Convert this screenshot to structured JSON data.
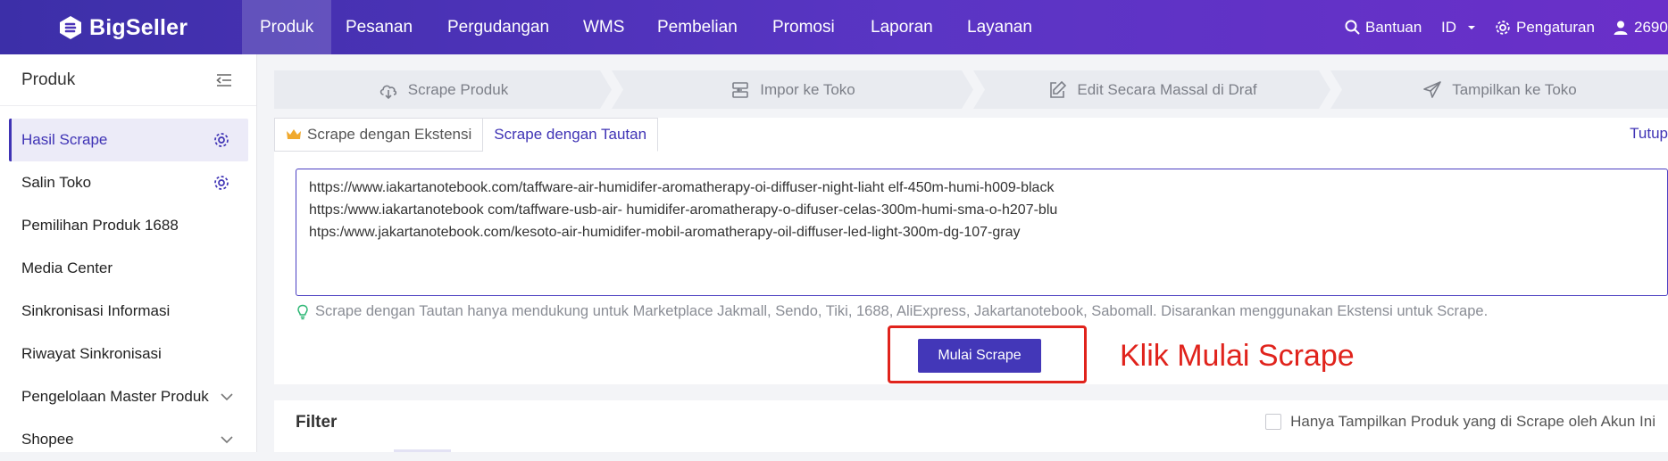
{
  "brand": {
    "name": "BigSeller"
  },
  "nav": {
    "items": [
      "Produk",
      "Pesanan",
      "Pergudangan",
      "WMS",
      "Pembelian",
      "Promosi",
      "Laporan",
      "Layanan"
    ],
    "active": "Produk",
    "help": "Bantuan",
    "language": "ID",
    "settings": "Pengaturan",
    "user": "2690"
  },
  "sidebar": {
    "title": "Produk",
    "items": [
      {
        "label": "Hasil Scrape",
        "active": true,
        "icon": "gear-icon"
      },
      {
        "label": "Salin Toko",
        "icon": "gear-icon"
      },
      {
        "label": "Pemilihan Produk 1688"
      },
      {
        "label": "Media Center"
      },
      {
        "label": "Sinkronisasi Informasi"
      },
      {
        "label": "Riwayat Sinkronisasi"
      },
      {
        "label": "Pengelolaan Master Produk",
        "icon": "chevron-down-icon"
      },
      {
        "label": "Shopee",
        "icon": "chevron-down-icon"
      }
    ]
  },
  "steps": [
    {
      "label": "Scrape Produk",
      "icon": "cloud-download-icon"
    },
    {
      "label": "Impor ke Toko",
      "icon": "import-icon"
    },
    {
      "label": "Edit Secara Massal di Draf",
      "icon": "edit-icon"
    },
    {
      "label": "Tampilkan ke Toko",
      "icon": "send-icon"
    }
  ],
  "tabs": {
    "extension": "Scrape dengan Ekstensi",
    "link": "Scrape dengan Tautan",
    "active": "Scrape dengan Tautan",
    "close": "Tutup"
  },
  "url_input": {
    "value": "https://www.iakartanotebook.com/taffware-air-humidifer-aromatherapy-oi-diffuser-night-liaht elf-450m-humi-h009-black\nhttps:/www.iakartanotebook com/taffware-usb-air- humidifer-aromatherapy-o-difuser-celas-300m-humi-sma-o-h207-blu\nhtps:/www.jakartanotebook.com/kesoto-air-humidifer-mobil-aromatherapy-oil-diffuser-led-light-300m-dg-107-gray"
  },
  "hint": "Scrape dengan Tautan hanya mendukung untuk Marketplace Jakmall, Sendo, Tiki, 1688, AliExpress, Jakartanotebook, Sabomall. Disarankan menggunakan Ekstensi untuk Scrape.",
  "start_button": "Mulai Scrape",
  "annotation": "Klik Mulai Scrape",
  "filter": {
    "title": "Filter",
    "own_only": "Hanya Tampilkan Produk yang di Scrape oleh Akun Ini"
  },
  "colors": {
    "nav_gradient_start": "#3c2fa8",
    "nav_gradient_end": "#6a2fc9",
    "primary": "#4337b8",
    "annotation_red": "#e0231c"
  }
}
